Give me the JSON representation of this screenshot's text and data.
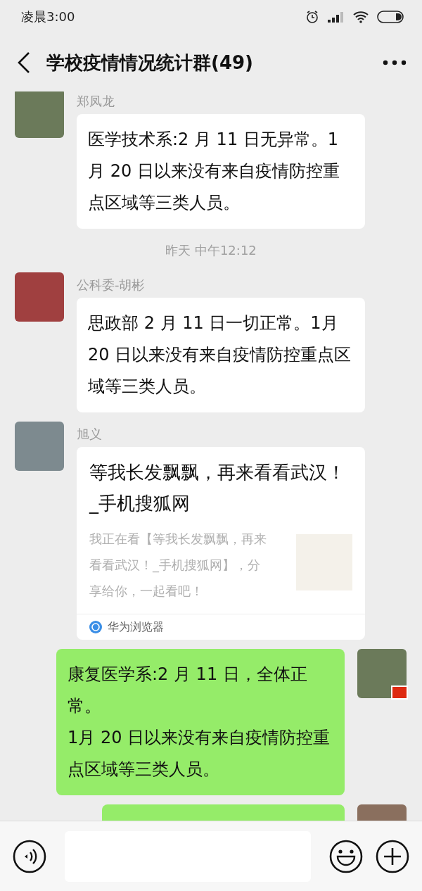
{
  "status_bar": {
    "time": "凌晨3:00"
  },
  "header": {
    "title": "学校疫情情况统计群(49)"
  },
  "messages": [
    {
      "kind": "incoming-text",
      "sender": "郑凤龙",
      "text": "医学技术系:2 月 11 日无异常。1月 20 日以来没有来自疫情防控重点区域等三类人员。"
    },
    {
      "kind": "time",
      "text": "昨天 中午12:12"
    },
    {
      "kind": "incoming-text",
      "sender": "公科委-胡彬",
      "text": "思政部 2 月 11 日一切正常。1月 20 日以来没有来自疫情防控重点区域等三类人员。"
    },
    {
      "kind": "incoming-link",
      "sender": "旭义",
      "title": "等我长发飘飘，再来看看武汉！_手机搜狐网",
      "description": "我正在看【等我长发飘飘，再来看看武汉！_手机搜狐网】，分享给你，一起看吧！",
      "source": "华为浏览器"
    },
    {
      "kind": "outgoing-text",
      "flag": true,
      "text": "康复医学系:2 月 11 日，全体正常。\n1月 20 日以来没有来自疫情防控重点区域等三类人员。"
    },
    {
      "kind": "outgoing-partial"
    }
  ]
}
